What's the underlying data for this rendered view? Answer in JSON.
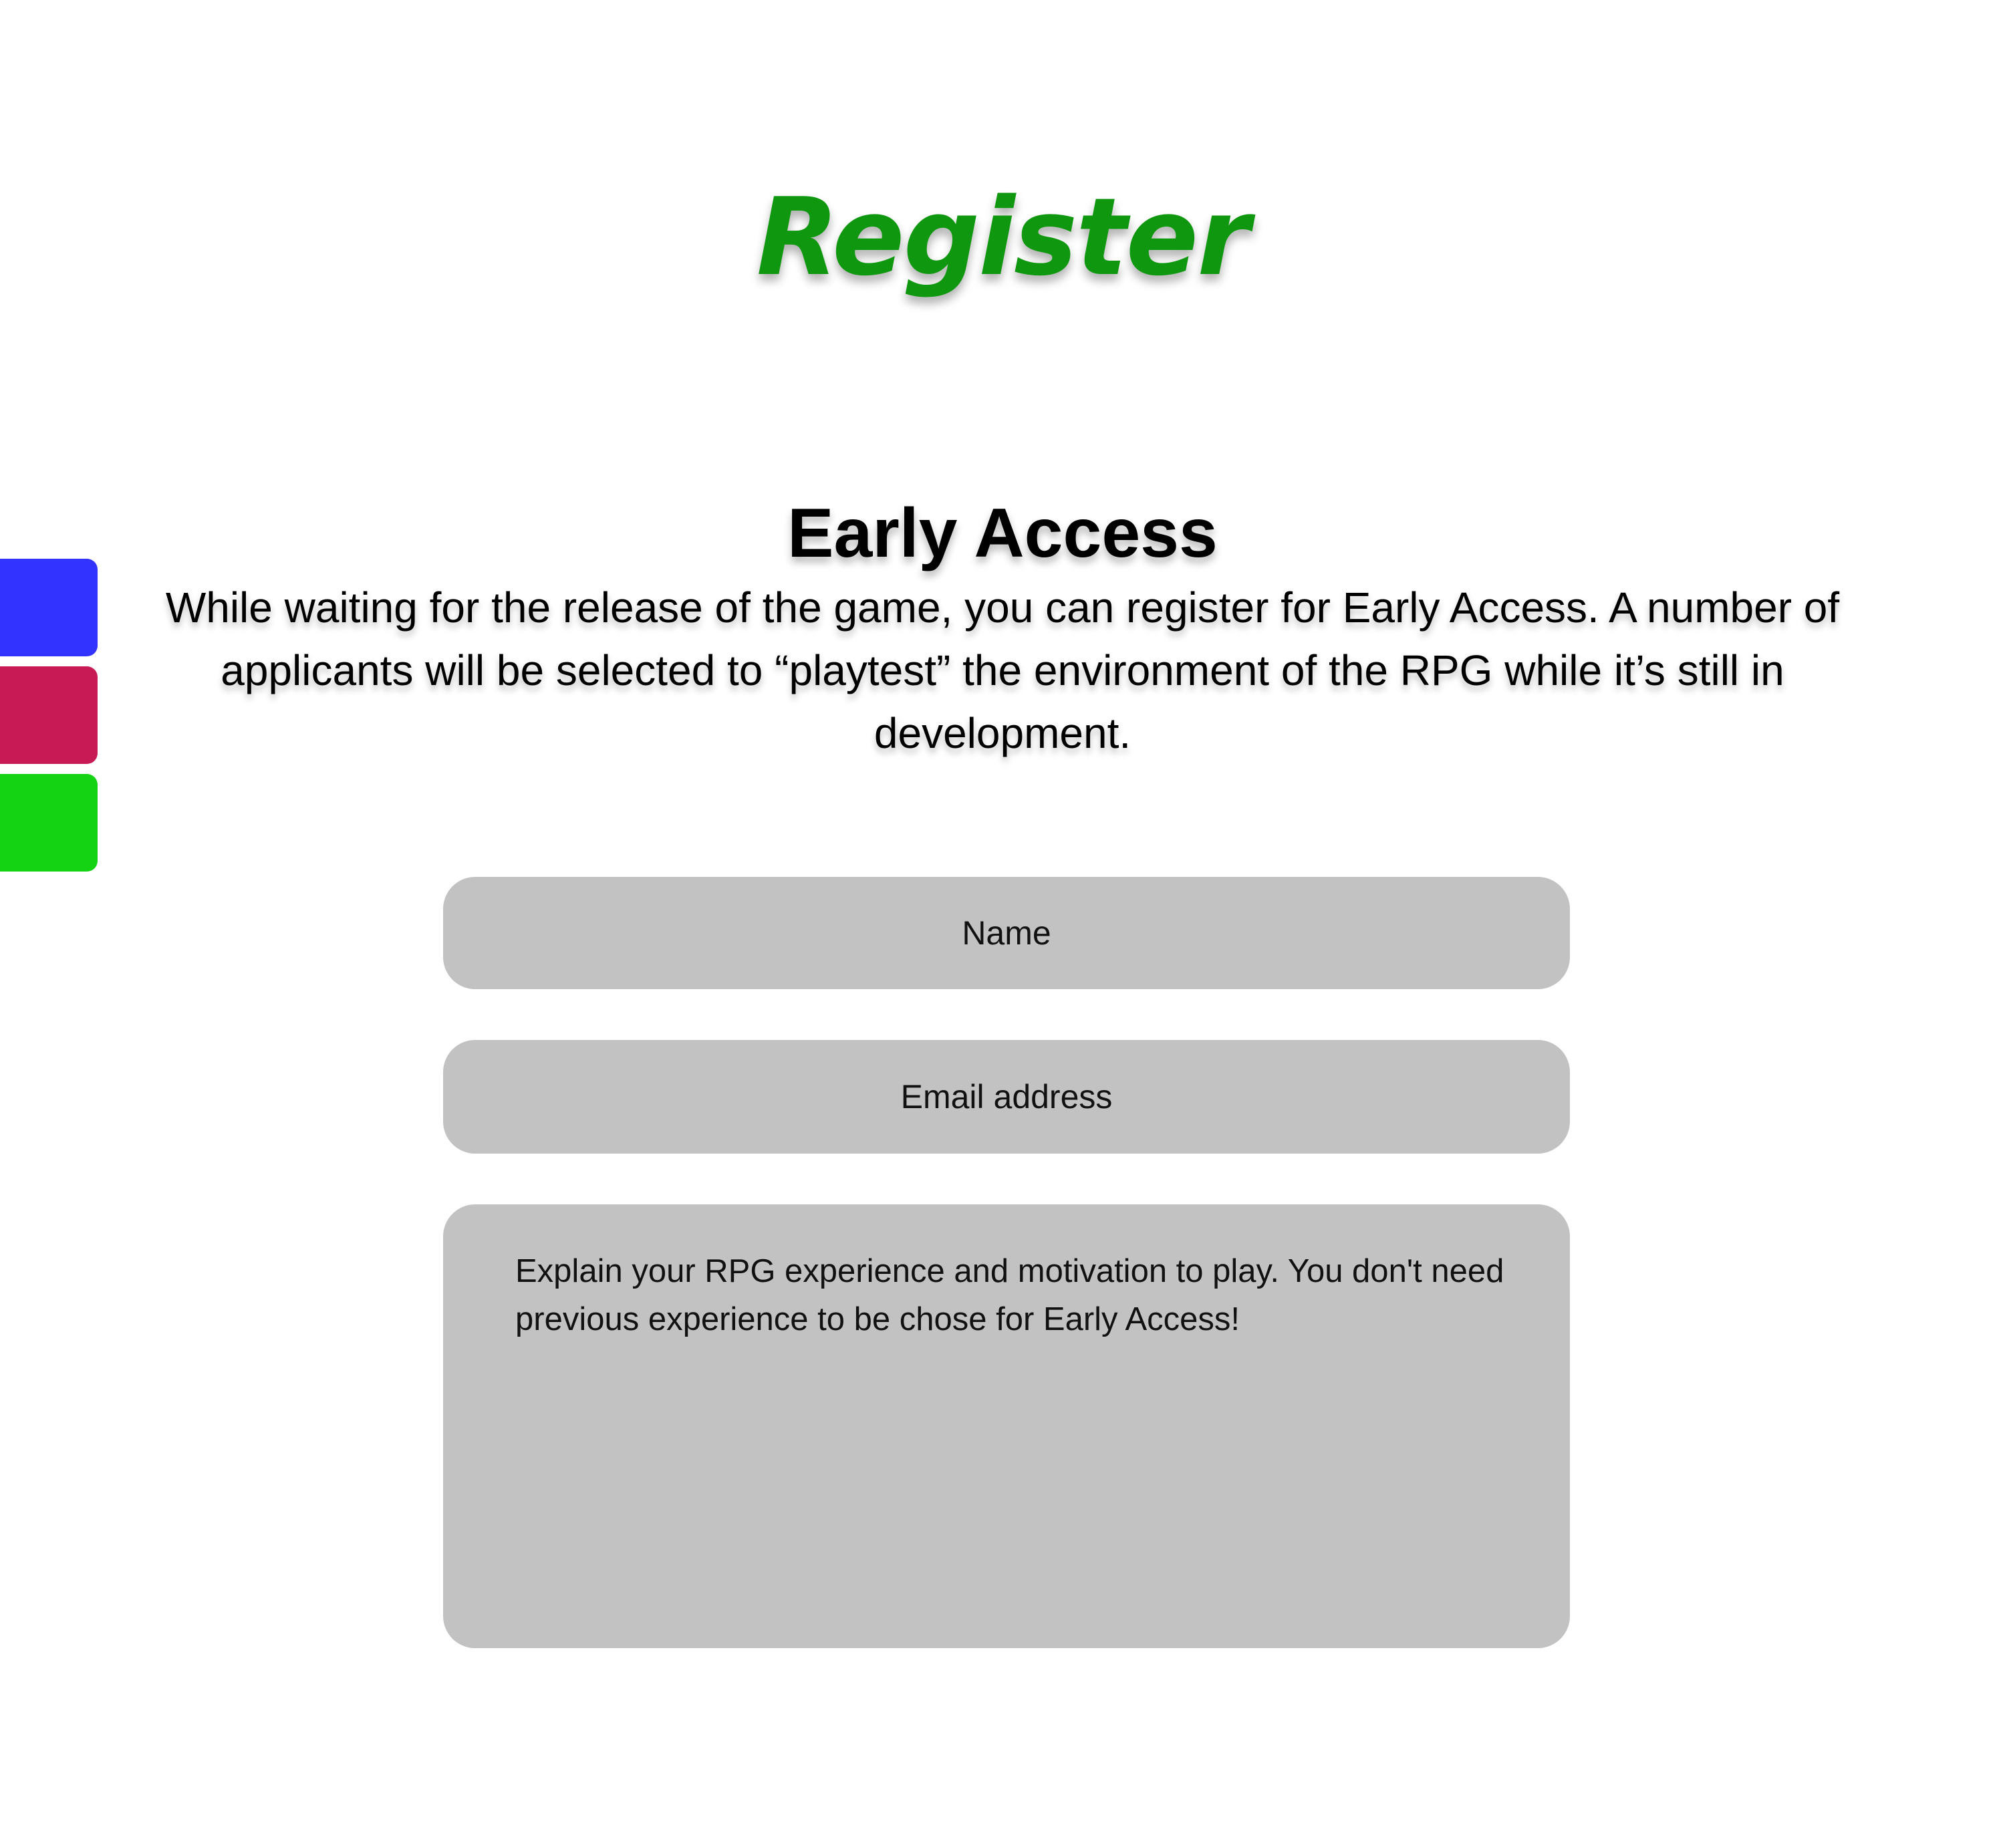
{
  "page": {
    "title": "Register"
  },
  "early_access": {
    "heading": "Early Access",
    "description": "While waiting for the release of the game, you can register for Early Access. A number of applicants will be selected to “playtest” the environment of the RPG while it’s still in development."
  },
  "side_swatches": [
    {
      "color": "#3333ff"
    },
    {
      "color": "#c81a55"
    },
    {
      "color": "#13d313"
    }
  ],
  "form": {
    "name_placeholder": "Name",
    "email_placeholder": "Email address",
    "message_placeholder": "Explain your RPG experience and motivation to play. You don't need previous experience to be chose for Early Access!"
  },
  "colors": {
    "title": "#0f970f",
    "field_background": "#c2c2c2"
  }
}
